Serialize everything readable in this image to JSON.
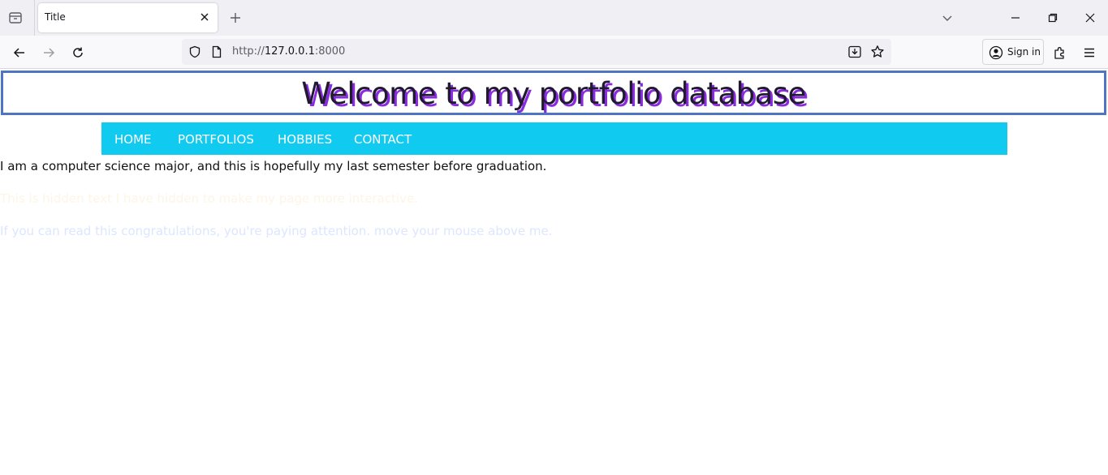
{
  "browser": {
    "tab_title": "Title",
    "url_scheme": "http://",
    "url_host": "127.0.0.1",
    "url_port": ":8000",
    "signin_label": "Sign in"
  },
  "page": {
    "heading": "Welcome to my portfolio database",
    "nav": [
      {
        "label": "HOME"
      },
      {
        "label": "PORTFOLIOS"
      },
      {
        "label": "HOBBIES"
      },
      {
        "label": "CONTACT"
      }
    ],
    "paragraphs": [
      "I am a computer science major, and this is hopefully my last semester before graduation.",
      "This is hidden text I have hidden to make my page more interactive.",
      "If you can read this congratulations, you're paying attention. move your mouse above me."
    ]
  },
  "colors": {
    "header_border": "#4f74c4",
    "heading_shadow": "#8a2be2",
    "nav_background": "#10cbef",
    "hidden_text_1": "#fdf5e6",
    "hidden_text_2": "#dce6ff"
  }
}
